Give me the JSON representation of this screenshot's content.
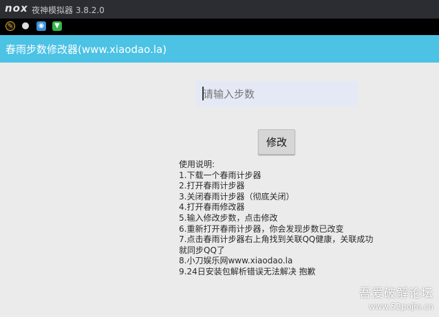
{
  "window": {
    "logo": "nox",
    "title": "夜神模拟器 3.8.2.0"
  },
  "statusbar": {
    "icons": [
      "app-launcher-icon",
      "wechat-icon",
      "app-store-icon",
      "download-icon"
    ]
  },
  "appbar": {
    "title": "春雨步数修改器(www.xiaodao.la)",
    "color": "#4cc2e4"
  },
  "form": {
    "placeholder": "请输入步数",
    "value": "",
    "button_label": "修改"
  },
  "instructions": {
    "heading": "使用说明:",
    "lines": [
      "1.下载一个春雨计步器",
      "2.打开春雨计步器",
      "3.关闭春雨计步器（彻底关闭）",
      "4.打开春雨修改器",
      "5.输入修改步数，点击修改",
      "6.重新打开春雨计步器，你会发现步数已改变",
      "7.点击春雨计步器右上角找到关联QQ健康，关联成功就同步QQ了",
      "8.小刀娱乐网www.xiaodao.la",
      "9.24日安装包解析错误无法解决 抱歉"
    ]
  },
  "watermark": {
    "title": "吾爱破解论坛",
    "url": "www.52pojie.cn"
  }
}
